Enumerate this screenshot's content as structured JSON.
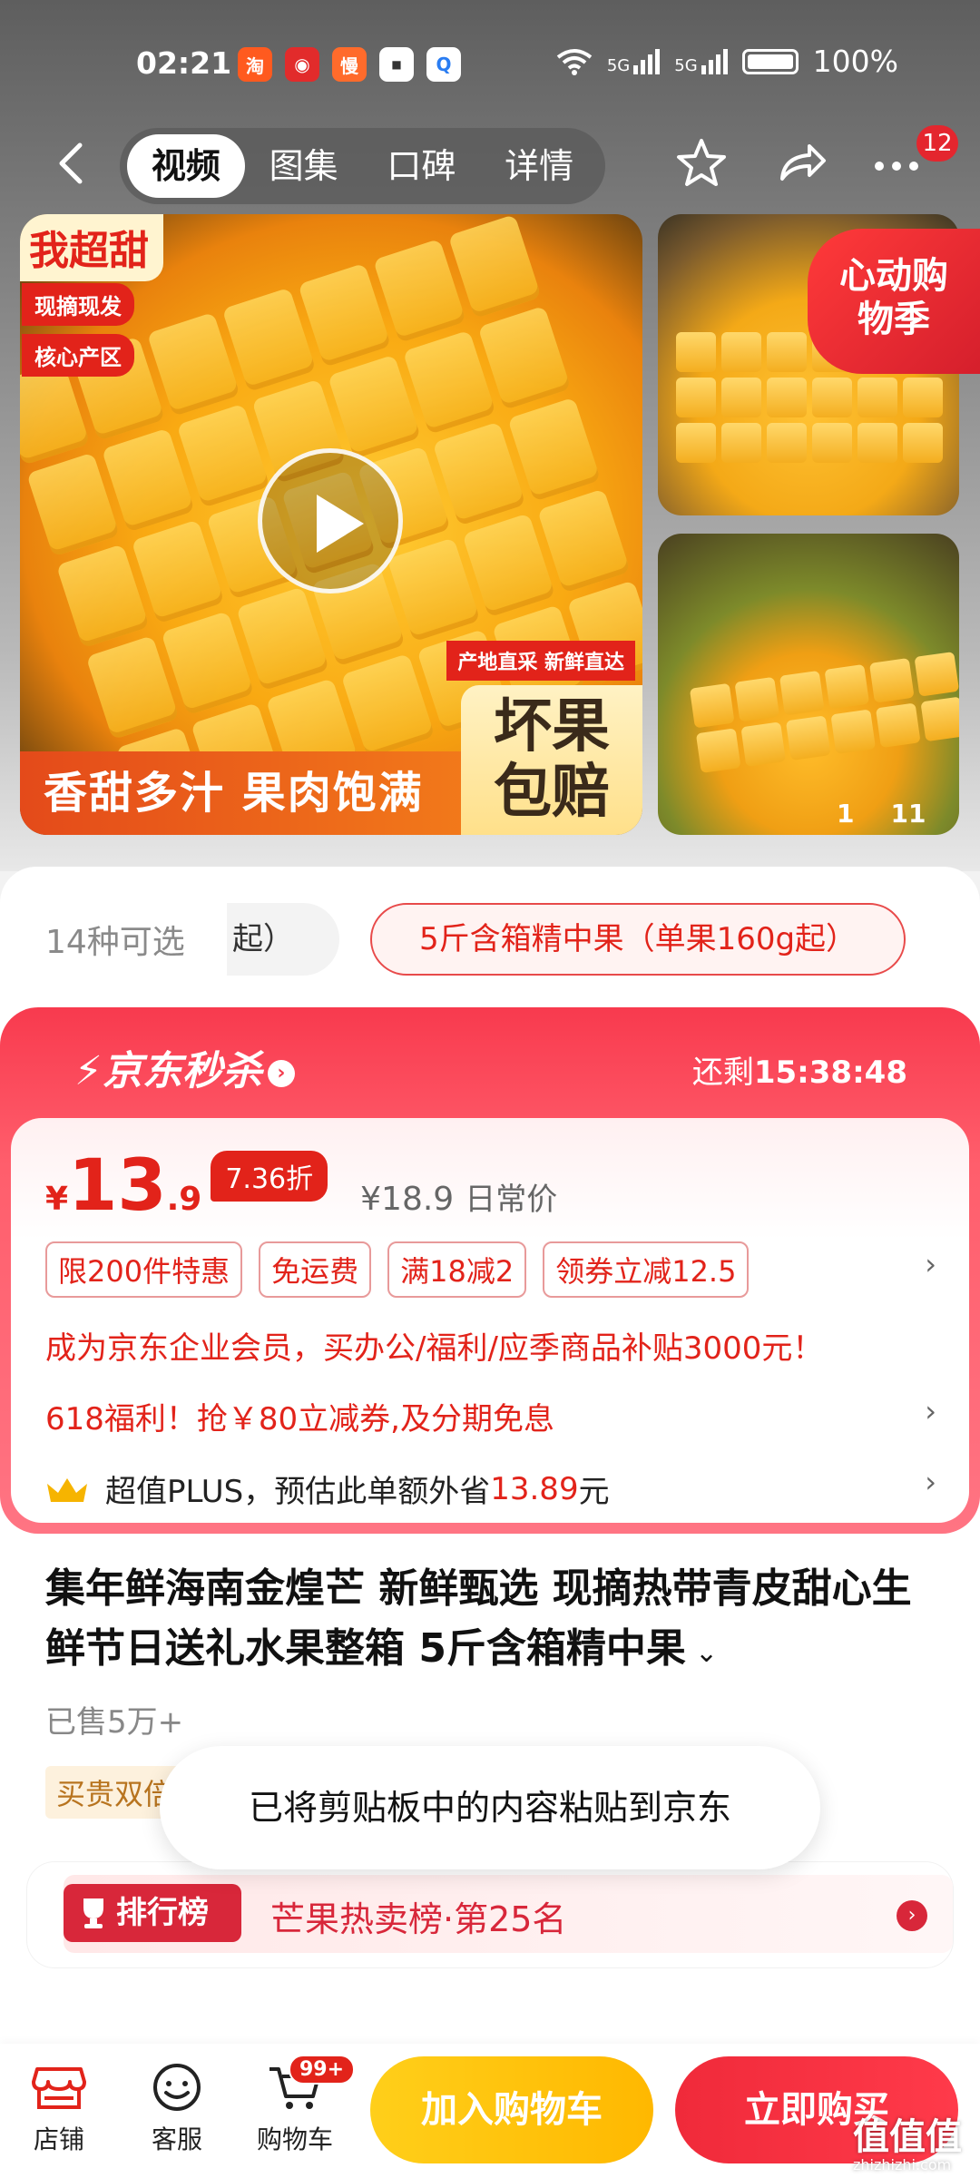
{
  "status_bar": {
    "time": "02:21",
    "network1": "5G",
    "network2": "5G",
    "battery": "100%"
  },
  "nav": {
    "tabs": [
      {
        "label": "视频",
        "active": true
      },
      {
        "label": "图集",
        "active": false
      },
      {
        "label": "口碑",
        "active": false
      },
      {
        "label": "详情",
        "active": false
      }
    ],
    "message_badge": "12"
  },
  "gallery": {
    "main_tag": "我超甜",
    "tags": [
      "现摘现发",
      "核心产区"
    ],
    "origin_tag": "产地直采 新鲜直达",
    "bottom_banner": "香甜多汁 果肉饱满",
    "guarantee": "坏果包赔",
    "promo_flag": "心动购物季",
    "counter_current": "1",
    "counter_total": "11"
  },
  "variant": {
    "count_label": "14种可选",
    "faded_option": "起）",
    "selected": "5斤含箱精中果（单果160g起）"
  },
  "seckill": {
    "title": "京东秒杀",
    "timer_label": "还剩",
    "timer": "15:38:48",
    "price_int": "13",
    "price_dec": ".9",
    "currency": "¥",
    "discount": "7.36折",
    "original_price": "¥18.9",
    "original_label": "日常价",
    "chips": [
      "限200件特惠",
      "免运费",
      "满18减2",
      "领券立减12.5"
    ],
    "enterprise_line": "成为京东企业会员，买办公/福利/应季商品补贴3000元！",
    "promo_line": "618福利！抢￥80立减券,及分期免息",
    "plus_prefix": "超值PLUS，预估此单额外省",
    "plus_amount": "13.89",
    "plus_suffix": "元"
  },
  "product": {
    "title": "集年鲜海南金煌芒 新鲜甄选 现摘热带青皮甜心生鲜节日送礼水果整箱 5斤含箱精中果",
    "sold": "已售5万+",
    "service_chip": "买贵双倍赔"
  },
  "rank": {
    "badge": "排行榜",
    "text": "芒果热卖榜·第25名"
  },
  "toast": "已将剪贴板中的内容粘贴到京东",
  "bottom_bar": {
    "shop": "店铺",
    "service": "客服",
    "cart": "购物车",
    "cart_badge": "99+",
    "add_to_cart": "加入购物车",
    "buy_now": "立即购买"
  },
  "watermark": {
    "main": "值值值",
    "sub": "zhizhizhi.com"
  },
  "colors": {
    "accent_red": "#e2231a",
    "seckill_red": "#f83a4e",
    "cart_yellow": "#ffc20e"
  }
}
